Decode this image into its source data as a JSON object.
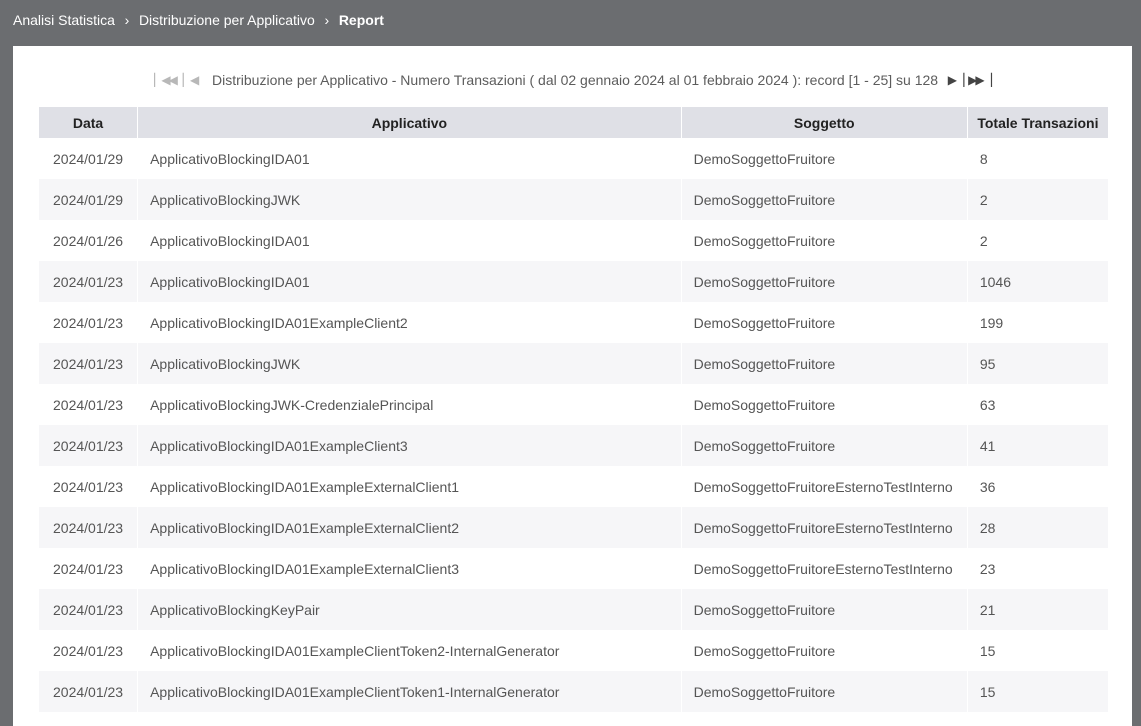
{
  "breadcrumb": {
    "items": [
      "Analisi Statistica",
      "Distribuzione per Applicativo",
      "Report"
    ]
  },
  "pager": {
    "label": "Distribuzione per Applicativo - Numero Transazioni ( dal 02 gennaio 2024 al 01 febbraio 2024 ): record [1 - 25] su 128",
    "icons": [
      "first-page-icon",
      "previous-page-icon",
      "next-page-icon",
      "last-page-icon"
    ]
  },
  "table": {
    "headers": [
      "Data",
      "Applicativo",
      "Soggetto",
      "Totale Transazioni"
    ],
    "rows": [
      [
        "2024/01/29",
        "ApplicativoBlockingIDA01",
        "DemoSoggettoFruitore",
        "8"
      ],
      [
        "2024/01/29",
        "ApplicativoBlockingJWK",
        "DemoSoggettoFruitore",
        "2"
      ],
      [
        "2024/01/26",
        "ApplicativoBlockingIDA01",
        "DemoSoggettoFruitore",
        "2"
      ],
      [
        "2024/01/23",
        "ApplicativoBlockingIDA01",
        "DemoSoggettoFruitore",
        "1046"
      ],
      [
        "2024/01/23",
        "ApplicativoBlockingIDA01ExampleClient2",
        "DemoSoggettoFruitore",
        "199"
      ],
      [
        "2024/01/23",
        "ApplicativoBlockingJWK",
        "DemoSoggettoFruitore",
        "95"
      ],
      [
        "2024/01/23",
        "ApplicativoBlockingJWK-CredenzialePrincipal",
        "DemoSoggettoFruitore",
        "63"
      ],
      [
        "2024/01/23",
        "ApplicativoBlockingIDA01ExampleClient3",
        "DemoSoggettoFruitore",
        "41"
      ],
      [
        "2024/01/23",
        "ApplicativoBlockingIDA01ExampleExternalClient1",
        "DemoSoggettoFruitoreEsternoTestInterno",
        "36"
      ],
      [
        "2024/01/23",
        "ApplicativoBlockingIDA01ExampleExternalClient2",
        "DemoSoggettoFruitoreEsternoTestInterno",
        "28"
      ],
      [
        "2024/01/23",
        "ApplicativoBlockingIDA01ExampleExternalClient3",
        "DemoSoggettoFruitoreEsternoTestInterno",
        "23"
      ],
      [
        "2024/01/23",
        "ApplicativoBlockingKeyPair",
        "DemoSoggettoFruitore",
        "21"
      ],
      [
        "2024/01/23",
        "ApplicativoBlockingIDA01ExampleClientToken2-InternalGenerator",
        "DemoSoggettoFruitore",
        "15"
      ],
      [
        "2024/01/23",
        "ApplicativoBlockingIDA01ExampleClientToken1-InternalGenerator",
        "DemoSoggettoFruitore",
        "15"
      ]
    ]
  }
}
